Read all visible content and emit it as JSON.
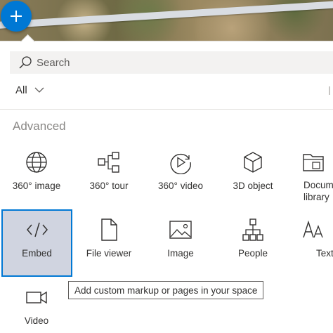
{
  "add_button": {
    "icon": "plus-icon",
    "color": "#0078d4"
  },
  "search": {
    "placeholder": "Search",
    "value": ""
  },
  "filter": {
    "label": "All"
  },
  "section": {
    "title": "Advanced"
  },
  "tiles": [
    {
      "label": "360° image",
      "icon": "globe-icon"
    },
    {
      "label": "360° tour",
      "icon": "tour-flow-icon"
    },
    {
      "label": "360° video",
      "icon": "play-circle-icon"
    },
    {
      "label": "3D object",
      "icon": "cube-icon"
    },
    {
      "label": "Document library",
      "icon": "folder-icon"
    },
    {
      "label": "Embed",
      "icon": "code-icon",
      "selected": true
    },
    {
      "label": "File viewer",
      "icon": "file-icon"
    },
    {
      "label": "Image",
      "icon": "image-icon"
    },
    {
      "label": "People",
      "icon": "org-chart-icon"
    },
    {
      "label": "Text",
      "icon": "text-icon"
    },
    {
      "label": "Video",
      "icon": "video-camera-icon"
    }
  ],
  "tooltip": {
    "text": "Add custom markup or pages in your space"
  },
  "colors": {
    "accent": "#0078d4",
    "selected_bg": "#d0d4e0"
  }
}
